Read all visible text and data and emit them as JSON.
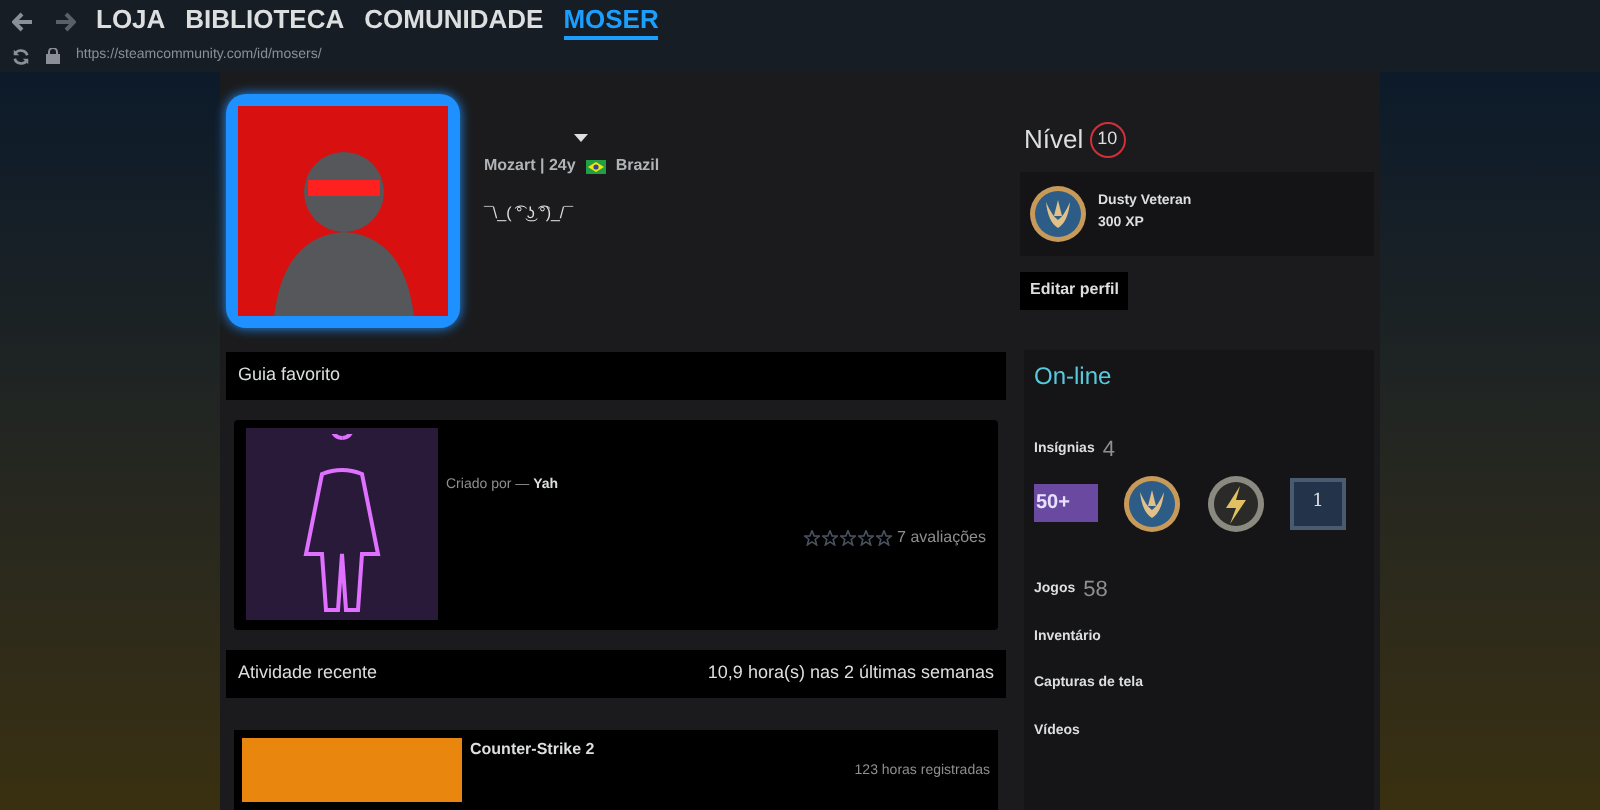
{
  "nav": {
    "tabs": [
      {
        "label": "LOJA",
        "selected": false
      },
      {
        "label": "BIBLIOTECA",
        "selected": false
      },
      {
        "label": "COMUNIDADE",
        "selected": false
      },
      {
        "label": "MOSER",
        "selected": true
      }
    ],
    "url": "https://steamcommunity.com/id/mosers/"
  },
  "profile": {
    "info": "Mozart | 24y",
    "country": "Brazil",
    "summary": "¯\\_( ͡° ͜ʖ ͡°)_/¯"
  },
  "level": {
    "label": "Nível",
    "value": "10"
  },
  "featured_badge": {
    "name": "Dusty Veteran",
    "xp": "300 XP"
  },
  "edit_button": "Editar perfil",
  "guide": {
    "title": "Guia favorito",
    "created_by": "Criado por —",
    "author": "Yah",
    "stars": 0,
    "reviews": "7 avaliações"
  },
  "activity": {
    "title": "Atividade recente",
    "hours": "10,9 hora(s) nas 2 últimas semanas",
    "game": "Counter-Strike 2",
    "played": "123 horas registradas"
  },
  "sidebar": {
    "status": "On-line",
    "badges_label": "Insígnias",
    "badges_count": "4",
    "badges": [
      {
        "kind": "years",
        "text": "50+"
      },
      {
        "kind": "coin"
      },
      {
        "kind": "bolt"
      },
      {
        "kind": "number",
        "text": "1"
      }
    ],
    "games_label": "Jogos",
    "games_count": "58",
    "links": [
      "Inventário",
      "Capturas de tela",
      "Vídeos"
    ]
  }
}
